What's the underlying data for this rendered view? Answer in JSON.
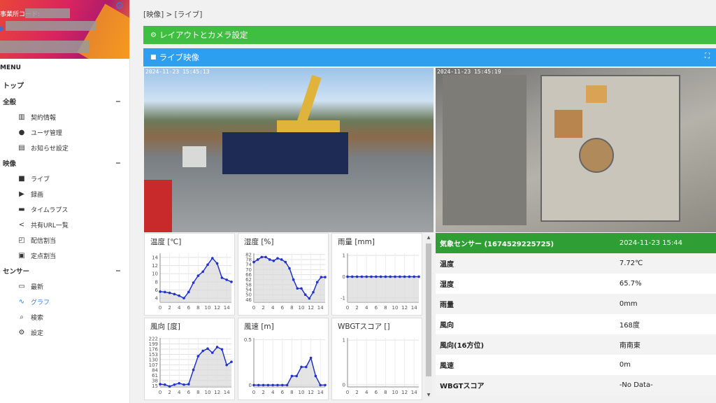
{
  "sidebar": {
    "company_code_label": "事業所コード:",
    "menu_label": "MENU",
    "top": "トップ",
    "sections": [
      {
        "label": "全般",
        "toggle": "−",
        "items": [
          {
            "label": "契約情報",
            "icon": "building-icon"
          },
          {
            "label": "ユーザ管理",
            "icon": "user-icon"
          },
          {
            "label": "お知らせ設定",
            "icon": "clipboard-icon"
          }
        ]
      },
      {
        "label": "映像",
        "toggle": "−",
        "items": [
          {
            "label": "ライブ",
            "icon": "video-icon"
          },
          {
            "label": "録画",
            "icon": "play-box-icon"
          },
          {
            "label": "タイムラプス",
            "icon": "timelapse-icon"
          },
          {
            "label": "共有URL一覧",
            "icon": "share-icon"
          },
          {
            "label": "配信割当",
            "icon": "cast-icon"
          },
          {
            "label": "定点割当",
            "icon": "camera-plus-icon"
          }
        ]
      },
      {
        "label": "センサー",
        "toggle": "−",
        "items": [
          {
            "label": "最新",
            "icon": "new-icon"
          },
          {
            "label": "グラフ",
            "icon": "graph-icon",
            "active": true
          },
          {
            "label": "検索",
            "icon": "search-icon"
          },
          {
            "label": "設定",
            "icon": "gear-icon"
          }
        ]
      }
    ]
  },
  "breadcrumb": "[映像] > [ライブ]",
  "layout_bar": "レイアウトとカメラ設定",
  "live_bar": "ライブ映像",
  "cameras": [
    {
      "timestamp": "2024-11-23 15:45:13"
    },
    {
      "timestamp": "2024-11-23 15:45:19"
    }
  ],
  "charts": [
    {
      "title": "温度 [℃]",
      "yticks": [
        "14",
        "12",
        "10",
        "8",
        "6",
        "4"
      ],
      "ymin": 3,
      "ymax": 15,
      "values": [
        5.6,
        5.5,
        5.3,
        5.0,
        4.6,
        4.0,
        5.5,
        7.8,
        9.5,
        10.5,
        12.2,
        13.8,
        12.5,
        9.0,
        8.5,
        8.0
      ]
    },
    {
      "title": "湿度 [%]",
      "yticks": [
        "82",
        "78",
        "74",
        "70",
        "66",
        "62",
        "58",
        "54",
        "50",
        "46"
      ],
      "ymin": 44,
      "ymax": 83,
      "values": [
        76,
        78,
        80,
        80,
        78,
        77,
        79,
        78,
        76,
        71,
        62,
        55,
        55,
        50,
        47,
        52,
        60,
        64,
        64
      ]
    },
    {
      "title": "雨量 [mm]",
      "yticks": [
        "1",
        "0",
        "-1"
      ],
      "ymin": -1.2,
      "ymax": 1.1,
      "values": [
        0,
        0,
        0,
        0,
        0,
        0,
        0,
        0,
        0,
        0,
        0,
        0,
        0,
        0,
        0,
        0
      ]
    },
    {
      "title": "風向 [度]",
      "yticks": [
        "222",
        "199",
        "176",
        "153",
        "130",
        "107",
        "84",
        "61",
        "38",
        "15"
      ],
      "ymin": 10,
      "ymax": 225,
      "values": [
        22,
        20,
        12,
        20,
        26,
        20,
        22,
        85,
        145,
        168,
        178,
        160,
        185,
        175,
        106,
        120
      ]
    },
    {
      "title": "風速 [m]",
      "yticks": [
        "0.5",
        "0"
      ],
      "ymin": -0.02,
      "ymax": 0.52,
      "values": [
        0,
        0,
        0,
        0,
        0,
        0,
        0,
        0,
        0.1,
        0.1,
        0.2,
        0.2,
        0.3,
        0.1,
        0,
        0
      ]
    },
    {
      "title": "WBGTスコア []",
      "yticks": [
        "1",
        "0"
      ],
      "ymin": -0.05,
      "ymax": 1.05,
      "values": []
    }
  ],
  "xticks": [
    "0",
    "2",
    "4",
    "6",
    "8",
    "10",
    "12",
    "14"
  ],
  "sensor": {
    "header": "気象センサー (1674529225725)",
    "datetime": "2024-11-23 15:44",
    "rows": [
      {
        "label": "温度",
        "value": "7.72℃"
      },
      {
        "label": "湿度",
        "value": "65.7%"
      },
      {
        "label": "雨量",
        "value": "0mm"
      },
      {
        "label": "風向",
        "value": "168度"
      },
      {
        "label": "風向(16方位)",
        "value": "南南東"
      },
      {
        "label": "風速",
        "value": "0m"
      },
      {
        "label": "WBGTスコア",
        "value": "-No Data-"
      }
    ]
  },
  "colors": {
    "green": "#3ebf3f",
    "blue": "#2d9ff0",
    "line": "#2233cc",
    "active": "#2a7fd6"
  }
}
